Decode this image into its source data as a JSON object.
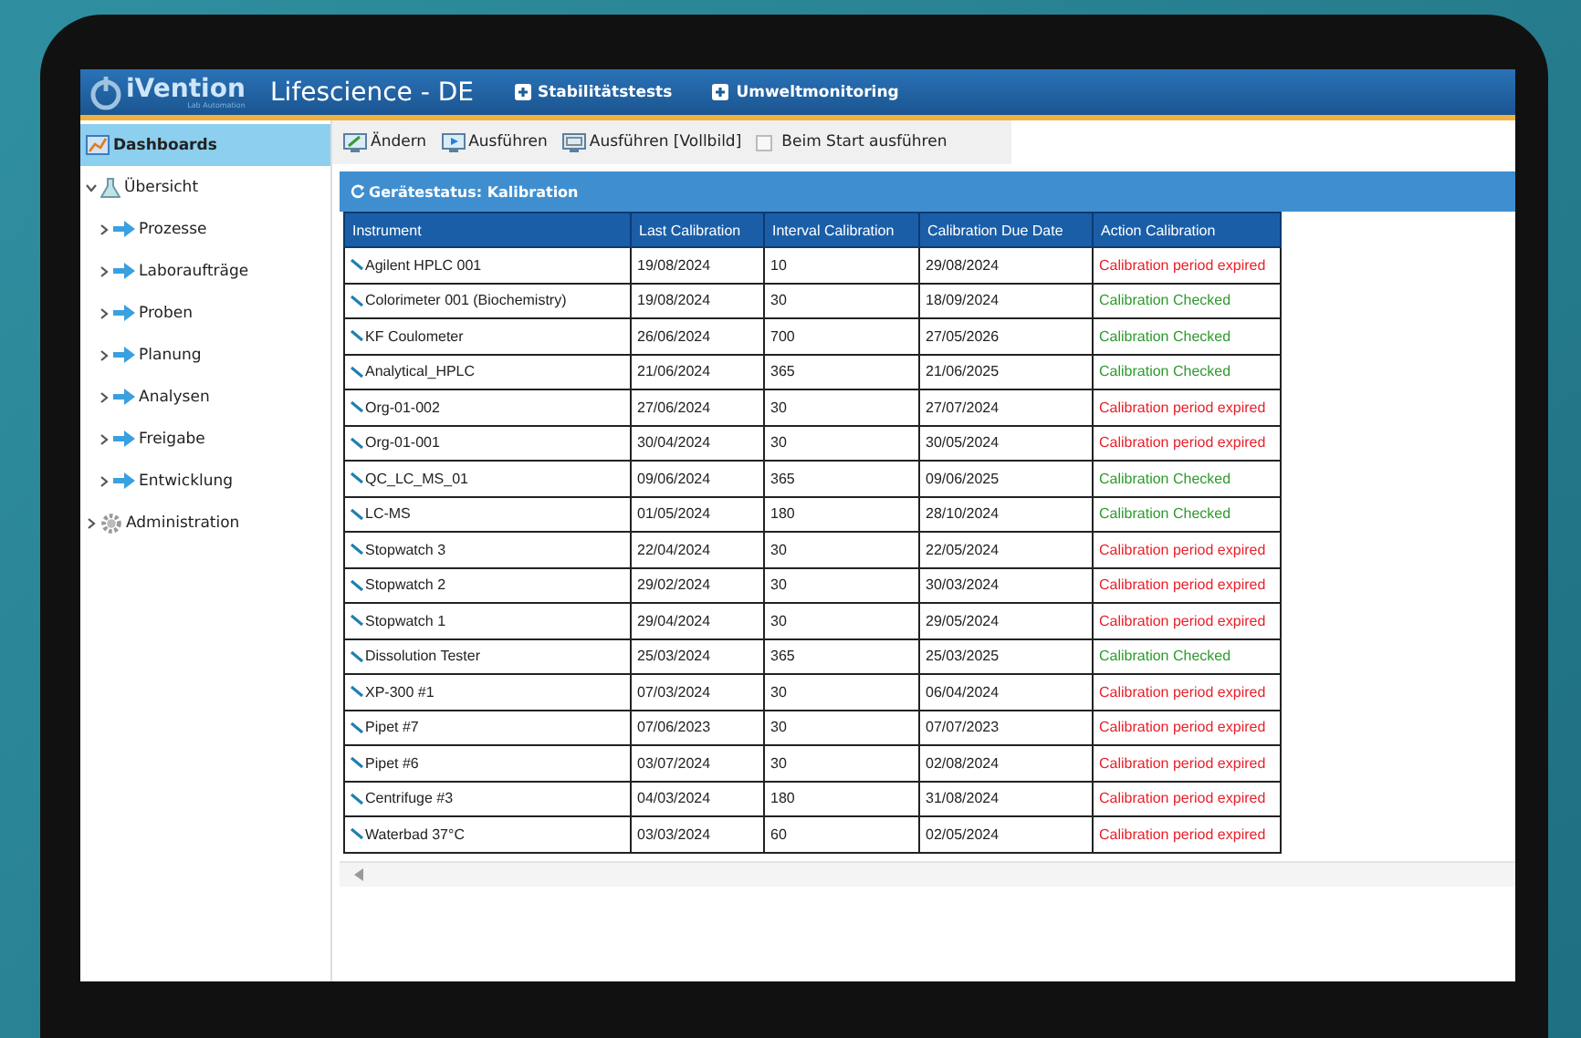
{
  "header": {
    "logo": "iVention",
    "logo_tagline": "Lab Automation",
    "title": "Lifescience - DE",
    "links": [
      "Stabilitätstests",
      "Umweltmonitoring"
    ]
  },
  "sidebar": {
    "items": [
      {
        "label": "Dashboards",
        "kind": "dashboard",
        "selected": true
      },
      {
        "label": "Übersicht",
        "kind": "flask",
        "selected": false,
        "expanded": true,
        "children": [
          {
            "label": "Prozesse",
            "kind": "arrow",
            "selected": false,
            "expanded": false
          },
          {
            "label": "Laboraufträge",
            "kind": "arrow",
            "selected": false,
            "expanded": false
          },
          {
            "label": "Proben",
            "kind": "arrow",
            "selected": false,
            "expanded": false
          },
          {
            "label": "Planung",
            "kind": "arrow",
            "selected": false,
            "expanded": false
          },
          {
            "label": "Analysen",
            "kind": "arrow",
            "selected": false,
            "expanded": false
          },
          {
            "label": "Freigabe",
            "kind": "arrow",
            "selected": false,
            "expanded": false
          },
          {
            "label": "Entwicklung",
            "kind": "arrow",
            "selected": false,
            "expanded": false
          }
        ]
      },
      {
        "label": "Administration",
        "kind": "gear",
        "selected": false,
        "expanded": false
      }
    ]
  },
  "toolbar": [
    {
      "label": "Ändern",
      "kind": "edit"
    },
    {
      "label": "Ausführen",
      "kind": "run"
    },
    {
      "label": "Ausführen [Vollbild]",
      "kind": "fullscreen"
    },
    {
      "label": "Beim Start ausführen",
      "kind": "checkbox",
      "checked": false
    }
  ],
  "panel": {
    "title": "Gerätestatus: Kalibration"
  },
  "table": {
    "columns": [
      "Instrument",
      "Last Calibration",
      "Interval Calibration",
      "Calibration Due Date",
      "Action Calibration"
    ],
    "rows": [
      {
        "instrument": "Agilent HPLC 001",
        "last": "19/08/2024",
        "interval": "10",
        "due": "29/08/2024",
        "action": "Calibration period expired",
        "kind": "expired"
      },
      {
        "instrument": "Colorimeter 001 (Biochemistry)",
        "last": "19/08/2024",
        "interval": "30",
        "due": "18/09/2024",
        "action": "Calibration Checked",
        "kind": "checked"
      },
      {
        "instrument": "KF Coulometer",
        "last": "26/06/2024",
        "interval": "700",
        "due": "27/05/2026",
        "action": "Calibration Checked",
        "kind": "checked"
      },
      {
        "instrument": "Analytical_HPLC",
        "last": "21/06/2024",
        "interval": "365",
        "due": "21/06/2025",
        "action": "Calibration Checked",
        "kind": "checked"
      },
      {
        "instrument": "Org-01-002",
        "last": "27/06/2024",
        "interval": "30",
        "due": "27/07/2024",
        "action": "Calibration period expired",
        "kind": "expired"
      },
      {
        "instrument": "Org-01-001",
        "last": "30/04/2024",
        "interval": "30",
        "due": "30/05/2024",
        "action": "Calibration period expired",
        "kind": "expired"
      },
      {
        "instrument": "QC_LC_MS_01",
        "last": "09/06/2024",
        "interval": "365",
        "due": "09/06/2025",
        "action": "Calibration Checked",
        "kind": "checked"
      },
      {
        "instrument": "LC-MS",
        "last": "01/05/2024",
        "interval": "180",
        "due": "28/10/2024",
        "action": "Calibration Checked",
        "kind": "checked"
      },
      {
        "instrument": "Stopwatch 3",
        "last": "22/04/2024",
        "interval": "30",
        "due": "22/05/2024",
        "action": "Calibration period expired",
        "kind": "expired"
      },
      {
        "instrument": "Stopwatch 2",
        "last": "29/02/2024",
        "interval": "30",
        "due": "30/03/2024",
        "action": "Calibration period expired",
        "kind": "expired"
      },
      {
        "instrument": "Stopwatch 1",
        "last": "29/04/2024",
        "interval": "30",
        "due": "29/05/2024",
        "action": "Calibration period expired",
        "kind": "expired"
      },
      {
        "instrument": "Dissolution Tester",
        "last": "25/03/2024",
        "interval": "365",
        "due": "25/03/2025",
        "action": "Calibration Checked",
        "kind": "checked"
      },
      {
        "instrument": "XP-300 #1",
        "last": "07/03/2024",
        "interval": "30",
        "due": "06/04/2024",
        "action": "Calibration period expired",
        "kind": "expired"
      },
      {
        "instrument": "Pipet #7",
        "last": "07/06/2023",
        "interval": "30",
        "due": "07/07/2023",
        "action": "Calibration period expired",
        "kind": "expired"
      },
      {
        "instrument": "Pipet #6",
        "last": "03/07/2024",
        "interval": "30",
        "due": "02/08/2024",
        "action": "Calibration period expired",
        "kind": "expired"
      },
      {
        "instrument": "Centrifuge #3",
        "last": "04/03/2024",
        "interval": "180",
        "due": "31/08/2024",
        "action": "Calibration period expired",
        "kind": "expired"
      },
      {
        "instrument": "Waterbad 37°C",
        "last": "03/03/2024",
        "interval": "60",
        "due": "02/05/2024",
        "action": "Calibration period expired",
        "kind": "expired"
      }
    ]
  }
}
